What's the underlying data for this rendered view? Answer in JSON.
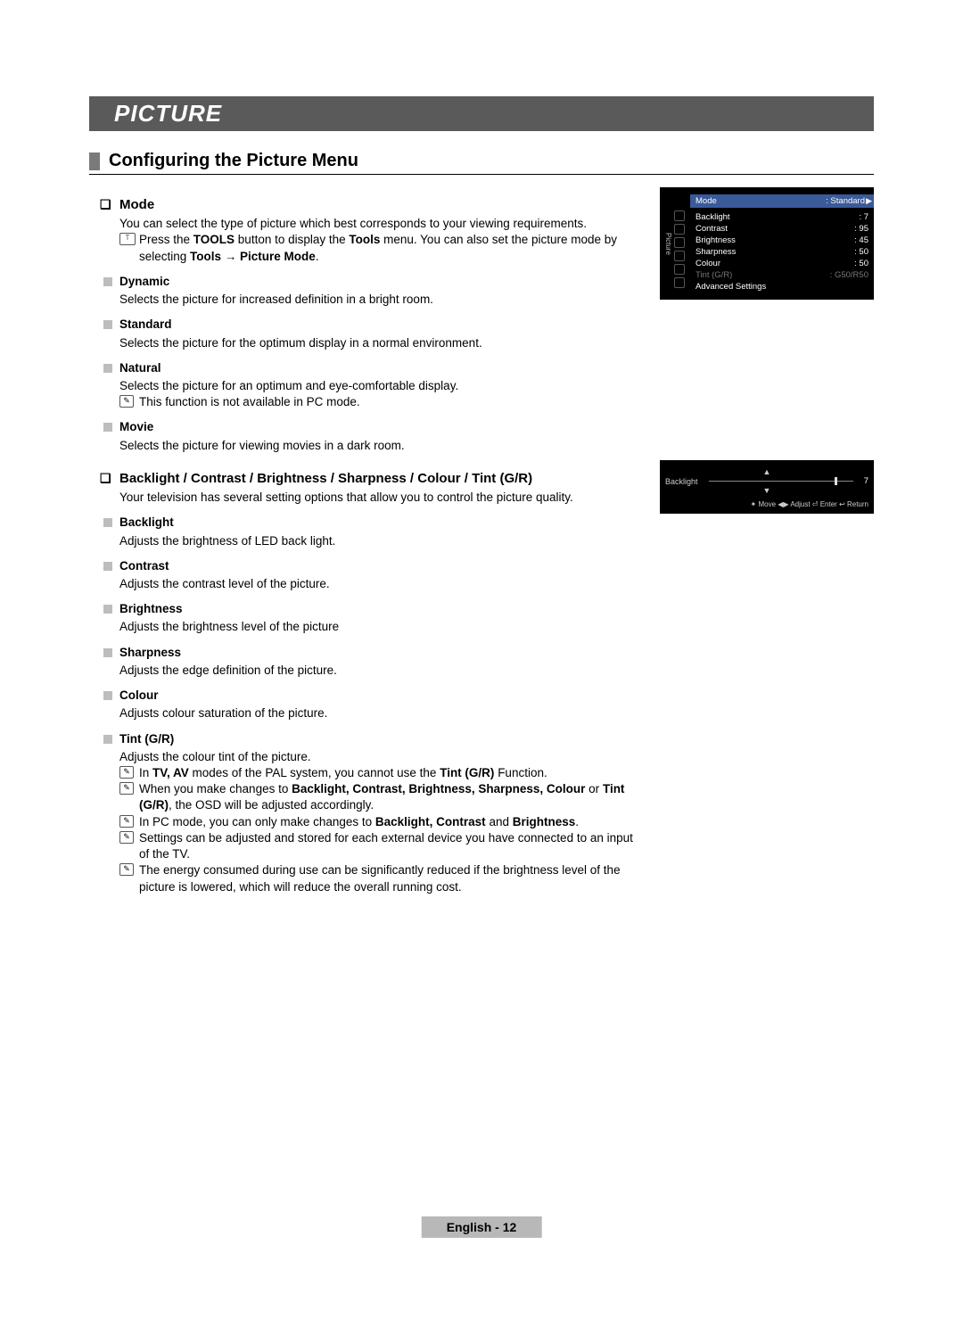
{
  "banner": "PICTURE",
  "section_title": "Configuring the Picture Menu",
  "mode": {
    "heading": "Mode",
    "intro": "You can select the type of picture which best corresponds to your viewing requirements.",
    "tools_note_pre": "Press the ",
    "tools_bold1": "TOOLS",
    "tools_mid1": " button to display the ",
    "tools_bold2": "Tools",
    "tools_mid2": " menu. You can also set the picture mode by selecting ",
    "tools_bold3": "Tools → Picture Mode",
    "tools_end": ".",
    "items": [
      {
        "name": "Dynamic",
        "desc": "Selects the picture for increased definition in a bright room."
      },
      {
        "name": "Standard",
        "desc": "Selects the picture for the optimum display in a normal environment."
      },
      {
        "name": "Natural",
        "desc": "Selects the picture for an optimum and eye-comfortable display.",
        "note": "This function is not available in PC mode."
      },
      {
        "name": "Movie",
        "desc": "Selects the picture for viewing movies in a dark room."
      }
    ]
  },
  "adjust": {
    "heading": "Backlight / Contrast / Brightness / Sharpness / Colour / Tint (G/R)",
    "intro": "Your television has several setting options that allow you to control the picture quality.",
    "items": [
      {
        "name": "Backlight",
        "desc": "Adjusts the brightness of LED back light."
      },
      {
        "name": "Contrast",
        "desc": "Adjusts the contrast level of the picture."
      },
      {
        "name": "Brightness",
        "desc": "Adjusts the brightness level of the picture"
      },
      {
        "name": "Sharpness",
        "desc": "Adjusts the edge definition of the picture."
      },
      {
        "name": "Colour",
        "desc": "Adjusts colour saturation of the picture."
      }
    ],
    "tint": {
      "name": "Tint (G/R)",
      "desc": "Adjusts the colour tint of the picture.",
      "notes": [
        {
          "pre": "In ",
          "b1": "TV, AV",
          "mid1": " modes of the PAL system, you cannot use the ",
          "b2": "Tint (G/R)",
          "end": " Function."
        },
        {
          "pre": "When you make changes to ",
          "b1": "Backlight, Contrast, Brightness, Sharpness, Colour",
          "mid1": " or ",
          "b2": "Tint (G/R)",
          "end": ", the OSD will be adjusted accordingly."
        },
        {
          "pre": "In PC mode, you can only make changes to ",
          "b1": "Backlight, Contrast",
          "mid1": " and ",
          "b2": "Brightness",
          "end": "."
        },
        {
          "plain": "Settings can be adjusted and stored for each external device you have connected to an input of the TV."
        },
        {
          "plain": "The energy consumed during use can be significantly reduced if the brightness level of the picture is lowered, which will reduce the overall running cost."
        }
      ]
    }
  },
  "osd1": {
    "side": "Picture",
    "mode_label": "Mode",
    "mode_value": ": Standard",
    "rows": [
      {
        "l": "Backlight",
        "v": ": 7"
      },
      {
        "l": "Contrast",
        "v": ": 95"
      },
      {
        "l": "Brightness",
        "v": ": 45"
      },
      {
        "l": "Sharpness",
        "v": ": 50"
      },
      {
        "l": "Colour",
        "v": ": 50"
      }
    ],
    "dim_row": {
      "l": "Tint (G/R)",
      "v": ": G50/R50"
    },
    "adv": "Advanced Settings"
  },
  "osd2": {
    "up": "▲",
    "label": "Backlight",
    "down": "▼",
    "value": "7",
    "foot": "✦ Move   ◀▶ Adjust   ⏎ Enter   ↩ Return"
  },
  "footer": "English - 12"
}
